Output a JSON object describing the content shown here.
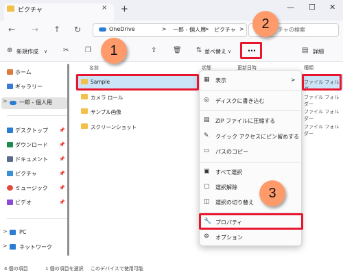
{
  "window": {
    "tab_title": "ピクチャ",
    "tab_close": "×",
    "new_tab": "+",
    "minimize": "—",
    "maximize": "☐",
    "close": "✕"
  },
  "address": {
    "crumbs": [
      "OneDrive",
      ">",
      "一郎 - 個人用",
      ">",
      "ピクチャ",
      ">"
    ],
    "search_placeholder": "チャの検索"
  },
  "toolbar": {
    "new_label": "新規作成",
    "sort_label": "並べ替え",
    "more_label": "…",
    "details_label": "詳細"
  },
  "sidebar": {
    "items": [
      {
        "label": "ホーム",
        "color": "#e07a3a"
      },
      {
        "label": "ギャラリー",
        "color": "#3a7bd5"
      },
      {
        "label": "一郎 - 個人用",
        "color": "#2b7cd3"
      },
      {
        "label": "デスクトップ",
        "color": "#2b7cd3"
      },
      {
        "label": "ダウンロード",
        "color": "#1e8c4e"
      },
      {
        "label": "ドキュメント",
        "color": "#5a6a8a"
      },
      {
        "label": "ピクチャ",
        "color": "#3a8fd5"
      },
      {
        "label": "ミュージック",
        "color": "#e04a3a"
      },
      {
        "label": "ビデオ",
        "color": "#8a4ad5"
      },
      {
        "label": "PC",
        "color": "#2b7cd3"
      },
      {
        "label": "ネットワーク",
        "color": "#2b7cd3"
      }
    ]
  },
  "files": {
    "col_name": "名前",
    "col_status": "状態",
    "col_date": "更新日時",
    "col_type": "種類",
    "rows": [
      {
        "name": "Sample",
        "type": "ファイル フォルダー"
      },
      {
        "name": "カメラ ロール",
        "type": "ファイル フォルダー"
      },
      {
        "name": "サンプル画像",
        "type": "ファイル フォルダー"
      },
      {
        "name": "スクリーンショット",
        "type": "ファイル フォルダー"
      }
    ]
  },
  "menu": {
    "items": [
      {
        "icon": "▦",
        "label": "表示",
        "arrow": ">"
      },
      {
        "icon": "◎",
        "label": "ディスクに書き込む"
      },
      {
        "icon": "▤",
        "label": "ZIP ファイルに圧縮する"
      },
      {
        "icon": "✎",
        "label": "クイック アクセスにピン留めする"
      },
      {
        "icon": "▭",
        "label": "パスのコピー"
      },
      {
        "icon": "▣",
        "label": "すべて選択"
      },
      {
        "icon": "▢",
        "label": "選択解除"
      },
      {
        "icon": "◫",
        "label": "選択の切り替え"
      },
      {
        "icon": "🔧",
        "label": "プロパティ"
      },
      {
        "icon": "⚙",
        "label": "オプション"
      }
    ]
  },
  "badges": [
    "1",
    "2",
    "3"
  ],
  "status": {
    "count": "4 個の項目",
    "selected": "1 個の項目を選択",
    "avail": "このデバイスで使用可能"
  },
  "colors": {
    "highlight": "#e8152e",
    "badge": "#ff9a6b",
    "selection": "#cce4f7",
    "folder": "#f3c14b"
  }
}
